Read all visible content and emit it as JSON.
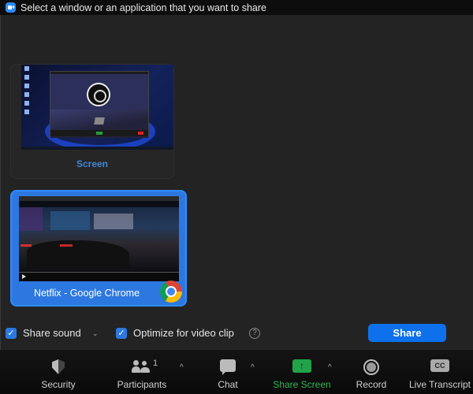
{
  "window": {
    "title": "Select a window or an application that you want to share",
    "app_icon": "zoom-icon"
  },
  "sources": [
    {
      "label": "Screen",
      "thumbnail": "desktop-with-obs-window",
      "selected": false
    },
    {
      "label": "Netflix - Google Chrome",
      "thumbnail": "netflix-video-night-street",
      "app_icon": "chrome-icon",
      "selected": true
    }
  ],
  "options": {
    "share_sound": {
      "label": "Share sound",
      "checked": true
    },
    "optimize_video": {
      "label": "Optimize for video clip",
      "checked": true
    },
    "help_glyph": "?",
    "share_button": "Share",
    "check_glyph": "✓",
    "caret_glyph": "⌄"
  },
  "toolbar": {
    "items": [
      {
        "label": "Security",
        "icon": "shield-icon"
      },
      {
        "label": "Participants",
        "icon": "participants-icon",
        "count": "1"
      },
      {
        "label": "Chat",
        "icon": "chat-icon"
      },
      {
        "label": "Share Screen",
        "icon": "share-screen-icon",
        "glyph": "↑"
      },
      {
        "label": "Record",
        "icon": "record-icon"
      },
      {
        "label": "Live Transcript",
        "icon": "cc-icon",
        "glyph": "CC"
      }
    ],
    "chevron_glyph": "^"
  },
  "colors": {
    "accent": "#2d8cff",
    "share_button": "#0e71eb",
    "share_screen_green": "#21a34a",
    "selected_label": "#3c88d8"
  }
}
